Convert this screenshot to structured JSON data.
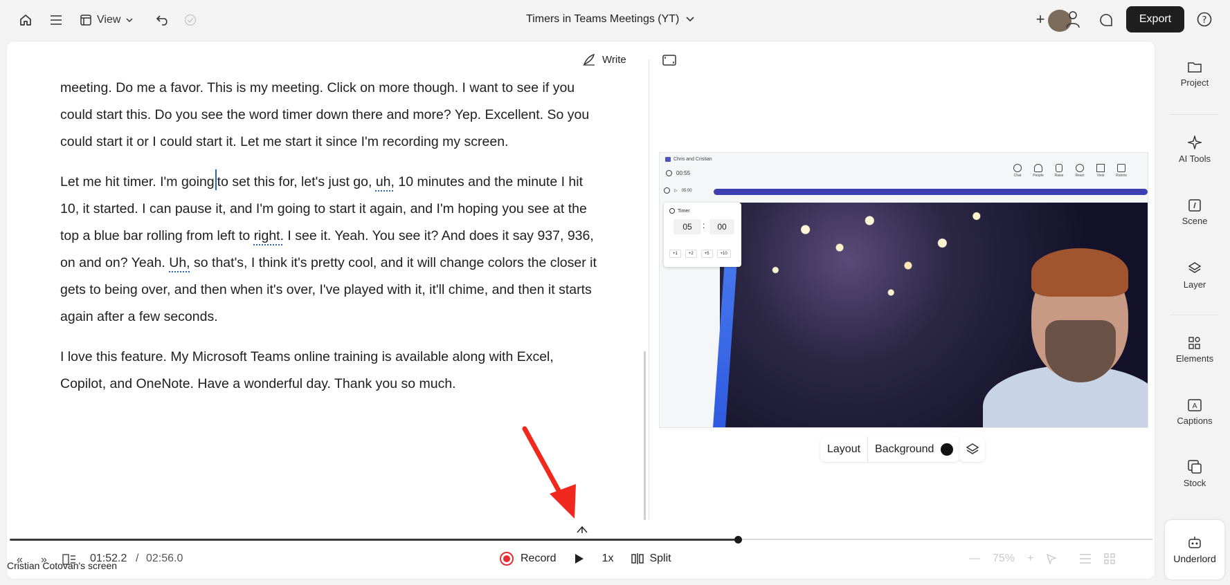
{
  "topbar": {
    "view_label": "View",
    "title": "Timers in Teams Meetings (YT)",
    "export_label": "Export"
  },
  "editor": {
    "write_label": "Write",
    "paragraphs": [
      "meeting. Do me a favor. This is my meeting. Click on more though. I want to see if you could start this. Do you see the word timer down there and more? Yep. Excellent. So you could start it or I could start it. Let me start it since I'm recording my screen.",
      "I love this feature. My Microsoft Teams online training is available along with Excel, Copilot, and OneNote. Have a wonderful day. Thank you so much."
    ],
    "p2": {
      "a": "Let me hit timer. I'm going",
      "b": "to set this for, let's just go, ",
      "uh1": "uh,",
      "c": " 10 minutes and the minute I hit 10, it started. I can pause it, and I'm going to start it again, and I'm hoping you see at the top a blue bar rolling from left to ",
      "right": "right.",
      "d": " I see it. Yeah. You see it? And does it say 937, 936, on and on? Yeah. ",
      "uh2": "Uh,",
      "e": " so that's, I think it's pretty cool, and it will change colors the closer it gets to being over, and then when it's over, I've played with it, it'll chime, and then it starts again after a few seconds."
    }
  },
  "video": {
    "meeting_title": "Chris and Cristian",
    "elapsed": "00:55",
    "timer_total": "05:00",
    "toolbar_items": [
      "Chat",
      "People",
      "Raise",
      "React",
      "View",
      "Rooms"
    ],
    "people_count": "2",
    "timer_card": {
      "title": "Timer",
      "minutes": "05",
      "seconds": "00",
      "increments": [
        "+1",
        "+2",
        "+5",
        "+10"
      ]
    }
  },
  "scene_controls": {
    "layout_label": "Layout",
    "background_label": "Background",
    "background_color": "#111111"
  },
  "rail": {
    "items": [
      "Project",
      "AI Tools",
      "Scene",
      "Layer",
      "Elements",
      "Captions",
      "Stock"
    ],
    "underlord_label": "Underlord"
  },
  "playback": {
    "current_time": "01:52.2",
    "separator": "/",
    "total_time": "02:56.0",
    "record_label": "Record",
    "speed_label": "1x",
    "split_label": "Split",
    "zoom_label": "75%",
    "progress": 0.64,
    "screen_caption": "Cristian Cotovan's screen"
  },
  "colors": {
    "accent_red": "#e03030",
    "timer_bar": "#3b3fb1",
    "export_bg": "#1f1f1f"
  }
}
